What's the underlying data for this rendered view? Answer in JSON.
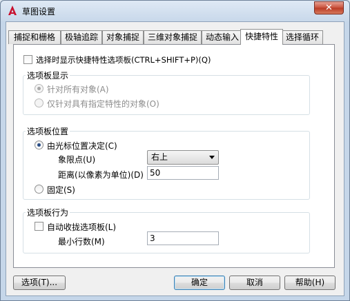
{
  "window": {
    "title": "草图设置",
    "close_label": "✕"
  },
  "tabs": [
    {
      "label": "捕捉和栅格"
    },
    {
      "label": "极轴追踪"
    },
    {
      "label": "对象捕捉"
    },
    {
      "label": "三维对象捕捉"
    },
    {
      "label": "动态输入"
    },
    {
      "label": "快捷特性",
      "active": true
    },
    {
      "label": "选择循环"
    }
  ],
  "panel": {
    "show_on_select_label": "选择时显示快捷特性选项板(CTRL+SHIFT+P)(Q)",
    "show_on_select_checked": false,
    "palette_display": {
      "title": "选项板显示",
      "option_all_label": "针对所有对象(A)",
      "option_specified_label": "仅针对具有指定特性的对象(O)",
      "selected": "all",
      "enabled": false
    },
    "palette_location": {
      "title": "选项板位置",
      "cursor_label": "由光标位置决定(C)",
      "quadrant_label": "象限点(U)",
      "quadrant_value": "右上",
      "distance_label": "距离(以像素为单位)(D)",
      "distance_value": "50",
      "fixed_label": "固定(S)",
      "selected": "cursor"
    },
    "palette_behavior": {
      "title": "选项板行为",
      "auto_collapse_label": "自动收拢选项板(L)",
      "auto_collapse_checked": false,
      "min_rows_label": "最小行数(M)",
      "min_rows_value": "3"
    }
  },
  "buttons": {
    "options": "选项(T)...",
    "ok": "确定",
    "cancel": "取消",
    "help": "帮助(H)"
  },
  "colors": {
    "accent": "#2a4d86",
    "icon_red": "#c8102e"
  }
}
